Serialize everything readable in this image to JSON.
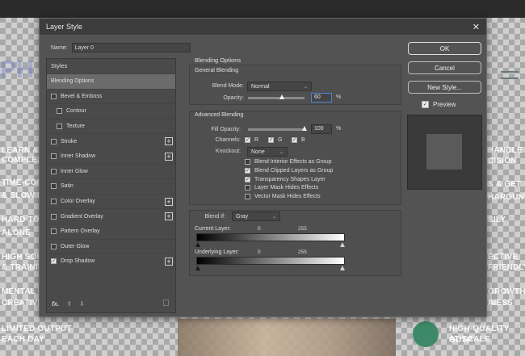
{
  "background": {
    "left_lines": [
      "LEARN & M",
      "COMPLEX",
      "TIME-CONS",
      "& SLOW PA",
      "HARD TO SE",
      "ALONE",
      "HIGH SOFT",
      "& TRAININ",
      "MENTAL FA",
      "CREATIVE",
      "LIMITED OUTPUT",
      "EACH DAY"
    ],
    "left_logo": "PH",
    "right_lines": [
      "HANDLE IT",
      "CISION",
      "S & GET",
      "HAROUND",
      "SILY",
      "ECTIVE",
      "FRIENDLY",
      "GROWTH A",
      "INESS",
      "HIGH-QUALITY OUTP",
      "AT SCALE"
    ]
  },
  "dialog": {
    "title": "Layer Style",
    "close_symbol": "✕",
    "name_label": "Name:",
    "name_value": "Layer 0",
    "styles_header": "Styles",
    "style_items": [
      {
        "label": "Blending Options",
        "checkbox": false,
        "checked": false,
        "plus": false,
        "active": true
      },
      {
        "label": "Bevel & Emboss",
        "checkbox": true,
        "checked": false,
        "plus": false
      },
      {
        "label": "Contour",
        "checkbox": true,
        "checked": false,
        "plus": false,
        "sub": true
      },
      {
        "label": "Texture",
        "checkbox": true,
        "checked": false,
        "plus": false,
        "sub": true
      },
      {
        "label": "Stroke",
        "checkbox": true,
        "checked": false,
        "plus": true
      },
      {
        "label": "Inner Shadow",
        "checkbox": true,
        "checked": false,
        "plus": true
      },
      {
        "label": "Inner Glow",
        "checkbox": true,
        "checked": false,
        "plus": false
      },
      {
        "label": "Satin",
        "checkbox": true,
        "checked": false,
        "plus": false
      },
      {
        "label": "Color Overlay",
        "checkbox": true,
        "checked": false,
        "plus": true
      },
      {
        "label": "Gradient Overlay",
        "checkbox": true,
        "checked": false,
        "plus": true
      },
      {
        "label": "Pattern Overlay",
        "checkbox": true,
        "checked": false,
        "plus": false
      },
      {
        "label": "Outer Glow",
        "checkbox": true,
        "checked": false,
        "plus": false
      },
      {
        "label": "Drop Shadow",
        "checkbox": true,
        "checked": true,
        "plus": true
      }
    ],
    "footer": {
      "fx": "fx.",
      "up": "⬆",
      "down": "⬇",
      "trash": "🗑"
    },
    "blending_options": {
      "title": "Blending Options",
      "general": {
        "title": "General Blending",
        "blend_mode_label": "Blend Mode:",
        "blend_mode_value": "Normal",
        "opacity_label": "Opacity:",
        "opacity_value": "60",
        "opacity_fraction": 0.6,
        "percent": "%"
      },
      "advanced": {
        "title": "Advanced Blending",
        "fill_opacity_label": "Fill Opacity:",
        "fill_opacity_value": "100",
        "fill_fraction": 1.0,
        "percent": "%",
        "channels_label": "Channels:",
        "channels": [
          "R",
          "G",
          "B"
        ],
        "knockout_label": "Knockout:",
        "knockout_value": "None",
        "options": [
          {
            "label": "Blend Interior Effects as Group",
            "checked": false
          },
          {
            "label": "Blend Clipped Layers as Group",
            "checked": true
          },
          {
            "label": "Transparency Shapes Layer",
            "checked": true
          },
          {
            "label": "Layer Mask Hides Effects",
            "checked": false
          },
          {
            "label": "Vector Mask Hides Effects",
            "checked": false
          }
        ]
      },
      "blend_if": {
        "label": "Blend If:",
        "value": "Gray",
        "current_layer_label": "Current Layer:",
        "underlying_layer_label": "Underlying Layer:",
        "min": "0",
        "max": "255"
      }
    },
    "buttons": {
      "ok": "OK",
      "cancel": "Cancel",
      "new_style": "New Style..."
    },
    "preview_label": "Preview",
    "preview_checked": true
  }
}
